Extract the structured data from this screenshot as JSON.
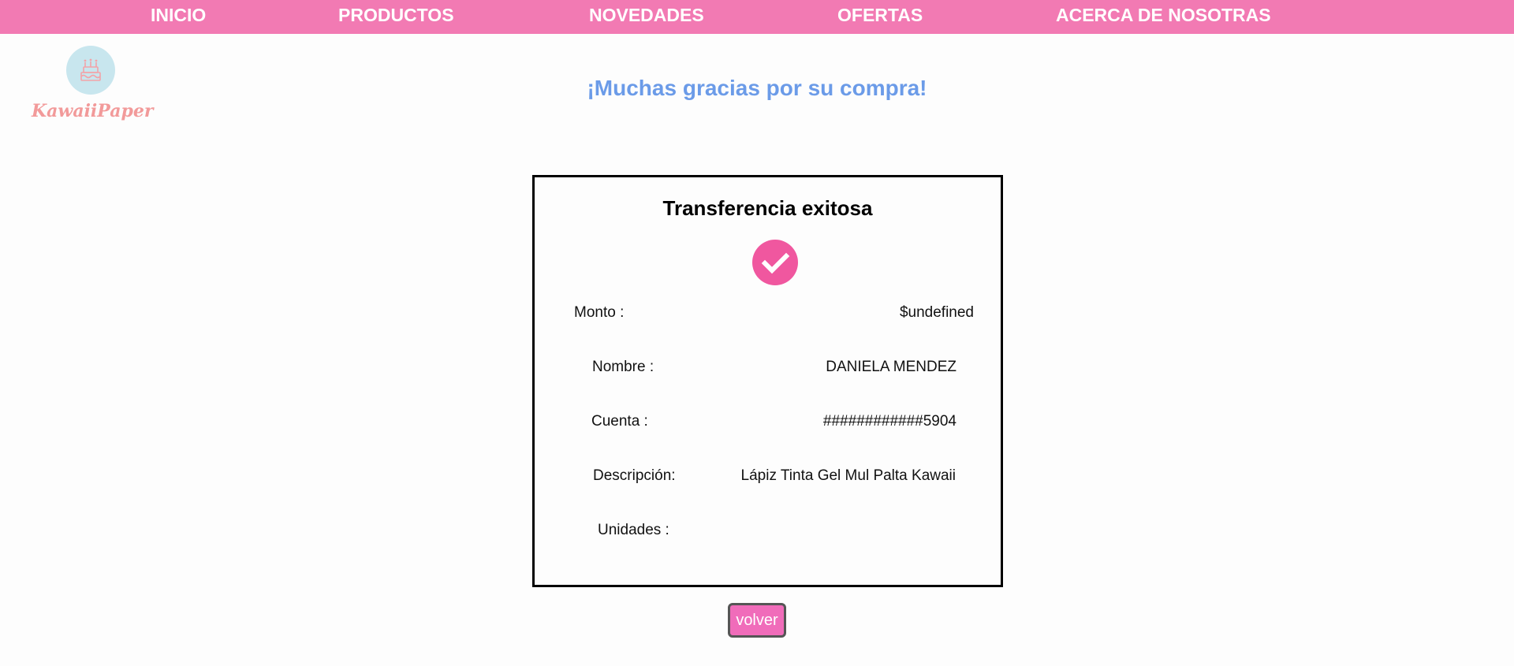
{
  "nav": {
    "items": [
      {
        "label": "INICIO"
      },
      {
        "label": "PRODUCTOS"
      },
      {
        "label": "NOVEDADES"
      },
      {
        "label": "OFERTAS"
      },
      {
        "label": "ACERCA DE NOSOTRAS"
      }
    ]
  },
  "logo": {
    "text": "KawaiiPaper",
    "icon": "cake-icon"
  },
  "page": {
    "heading": "¡Muchas gracias por su compra!"
  },
  "receipt": {
    "title": "Transferencia exitosa",
    "status_icon": "check-circle-icon",
    "rows": {
      "monto": {
        "label": "Monto :",
        "value": "$undefined"
      },
      "nombre": {
        "label": "Nombre :",
        "value": "DANIELA MENDEZ"
      },
      "cuenta": {
        "label": "Cuenta :",
        "value": "############5904"
      },
      "descripcion": {
        "label": "Descripción:",
        "value": "Lápiz Tinta Gel Mul Palta Kawaii"
      },
      "unidades": {
        "label": "Unidades :",
        "value": ""
      }
    }
  },
  "actions": {
    "back_label": "volver"
  },
  "colors": {
    "nav_bg": "#f27ab3",
    "heading": "#6b9be8",
    "check": "#f0579f",
    "button": "#f06cba",
    "logo_text": "#f29a9a",
    "logo_circle": "#c8e6ee"
  }
}
